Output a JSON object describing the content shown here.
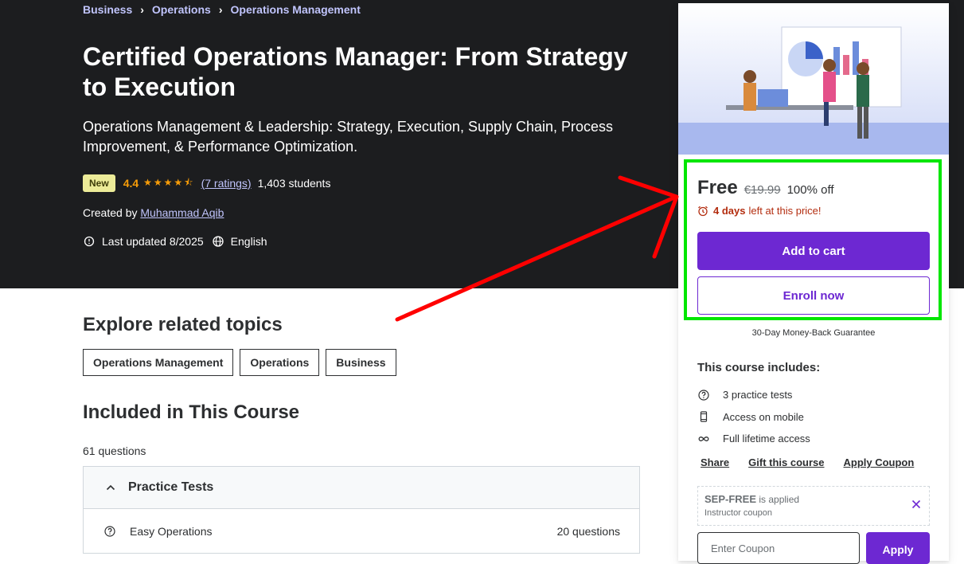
{
  "breadcrumb": {
    "items": [
      "Business",
      "Operations",
      "Operations Management"
    ]
  },
  "course": {
    "title": "Certified Operations Manager: From Strategy to Execution",
    "subtitle": "Operations Management & Leadership: Strategy, Execution, Supply Chain, Process Improvement, & Performance Optimization.",
    "badge": "New",
    "rating": "4.4",
    "rating_stars": 4.4,
    "ratings_link": "(7 ratings)",
    "students": "1,403 students",
    "created_by_label": "Created by",
    "instructor": "Muhammad Aqib",
    "last_updated": "Last updated 8/2025",
    "language": "English"
  },
  "related": {
    "heading": "Explore related topics",
    "topics": [
      "Operations Management",
      "Operations",
      "Business"
    ]
  },
  "included": {
    "heading": "Included in This Course",
    "question_count": "61 questions",
    "section_title": "Practice Tests",
    "rows": [
      {
        "title": "Easy Operations",
        "count": "20 questions"
      }
    ]
  },
  "sidebar": {
    "price": "Free",
    "original_price": "€19.99",
    "discount": "100% off",
    "timer_bold": "4 days",
    "timer_rest": "left at this price!",
    "add_to_cart": "Add to cart",
    "enroll_now": "Enroll now",
    "guarantee": "30-Day Money-Back Guarantee",
    "includes_heading": "This course includes:",
    "includes": [
      {
        "icon": "question-circle-icon",
        "label": "3 practice tests"
      },
      {
        "icon": "mobile-icon",
        "label": "Access on mobile"
      },
      {
        "icon": "infinity-icon",
        "label": "Full lifetime access"
      }
    ],
    "links": [
      "Share",
      "Gift this course",
      "Apply Coupon"
    ],
    "coupon": {
      "code": "SEP-FREE",
      "applied_text": "is applied",
      "type": "Instructor coupon"
    },
    "coupon_placeholder": "Enter Coupon",
    "apply_label": "Apply"
  },
  "colors": {
    "accent": "#6d28d2",
    "hero_bg": "#1c1d1f",
    "link": "#c0c4fc",
    "star": "#f69c08",
    "timer": "#b32d0f",
    "highlight": "#00e600",
    "annotation_arrow": "#ff0000"
  }
}
